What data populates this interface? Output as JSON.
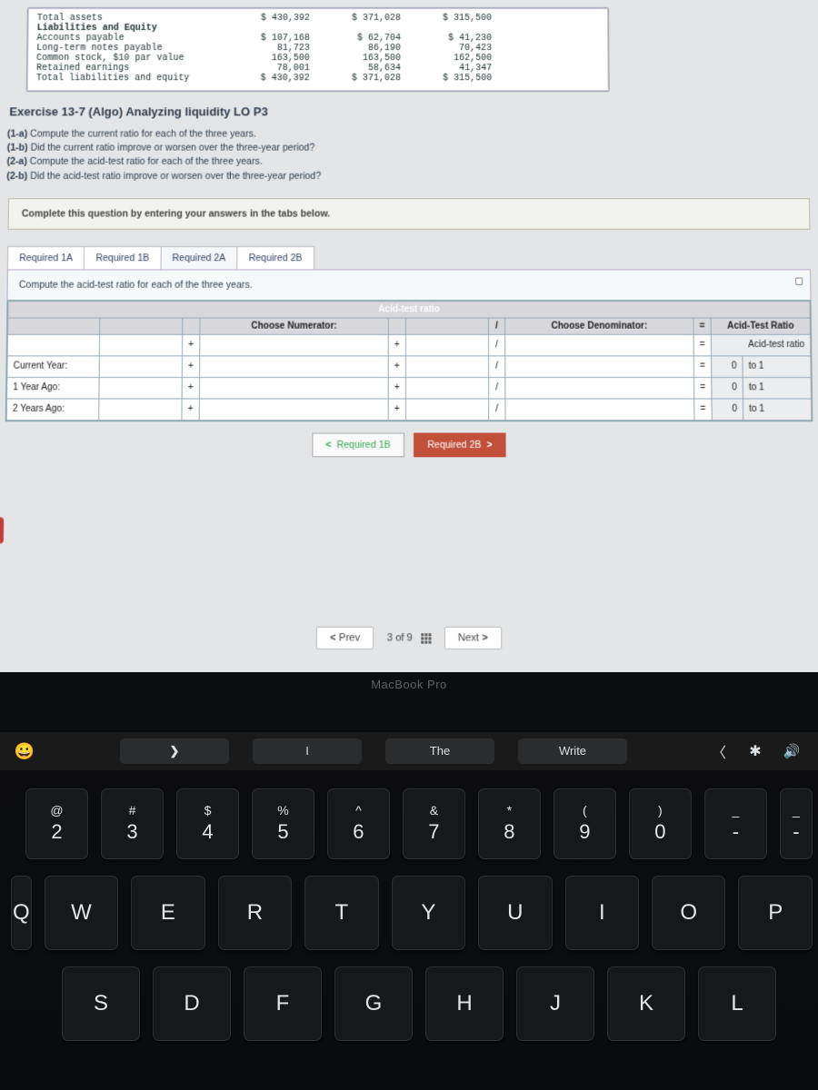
{
  "fin": {
    "rows": [
      {
        "label": "Total assets",
        "v1": "$ 430,392",
        "v2": "$ 371,028",
        "v3": "$ 315,500"
      },
      {
        "label": "Liabilities and Equity",
        "v1": "",
        "v2": "",
        "v3": ""
      },
      {
        "label": "Accounts payable",
        "v1": "$ 107,168",
        "v2": "$ 62,704",
        "v3": "$ 41,230"
      },
      {
        "label": "Long-term notes payable",
        "v1": "81,723",
        "v2": "86,190",
        "v3": "70,423"
      },
      {
        "label": "Common stock, $10 par value",
        "v1": "163,500",
        "v2": "163,500",
        "v3": "162,500"
      },
      {
        "label": "Retained earnings",
        "v1": "78,001",
        "v2": "58,634",
        "v3": "41,347"
      },
      {
        "label": "Total liabilities and equity",
        "v1": "$ 430,392",
        "v2": "$ 371,028",
        "v3": "$ 315,500"
      }
    ]
  },
  "exercise_title": "Exercise 13-7 (Algo) Analyzing liquidity LO P3",
  "questions": [
    {
      "tag": "(1-a)",
      "text": "Compute the current ratio for each of the three years."
    },
    {
      "tag": "(1-b)",
      "text": "Did the current ratio improve or worsen over the three-year period?"
    },
    {
      "tag": "(2-a)",
      "text": "Compute the acid-test ratio for each of the three years."
    },
    {
      "tag": "(2-b)",
      "text": "Did the acid-test ratio improve or worsen over the three-year period?"
    }
  ],
  "instruction": "Complete this question by entering your answers in the tabs below.",
  "tabs": [
    "Required 1A",
    "Required 1B",
    "Required 2A",
    "Required 2B"
  ],
  "active_tab": 2,
  "sub_instruction": "Compute the acid-test ratio for each of the three years.",
  "table": {
    "title": "Acid-test ratio",
    "num_header": "Choose Numerator:",
    "den_header": "Choose Denominator:",
    "res_header": "Acid-Test Ratio",
    "res_sub": "Acid-test ratio",
    "plus": "+",
    "div": "/",
    "eq": "=",
    "rows": [
      {
        "label": "",
        "r": "",
        "to": ""
      },
      {
        "label": "Current Year:",
        "r": "0",
        "to": "to 1"
      },
      {
        "label": "1 Year Ago:",
        "r": "0",
        "to": "to 1"
      },
      {
        "label": "2 Years Ago:",
        "r": "0",
        "to": "to 1"
      }
    ]
  },
  "step_nav": {
    "prev": "Required 1B",
    "next": "Required 2B"
  },
  "pager": {
    "prev": "Prev",
    "pos": "3 of 9",
    "next": "Next"
  },
  "brand": "MacBook Pro",
  "pred": {
    "arrow": "❯",
    "input": "I",
    "center": "The",
    "right": "Write"
  },
  "kbd": {
    "nums": [
      {
        "u": "@",
        "d": "2"
      },
      {
        "u": "#",
        "d": "3"
      },
      {
        "u": "$",
        "d": "4"
      },
      {
        "u": "%",
        "d": "5"
      },
      {
        "u": "^",
        "d": "6"
      },
      {
        "u": "&",
        "d": "7"
      },
      {
        "u": "*",
        "d": "8"
      },
      {
        "u": "(",
        "d": "9"
      },
      {
        "u": ")",
        "d": "0"
      },
      {
        "u": "_",
        "d": "-"
      }
    ],
    "r2_left": "Q",
    "r2": [
      "W",
      "E",
      "R",
      "T",
      "Y",
      "U",
      "I",
      "O",
      "P"
    ],
    "r3": [
      "S",
      "D",
      "F",
      "G",
      "H",
      "J",
      "K",
      "L"
    ]
  }
}
